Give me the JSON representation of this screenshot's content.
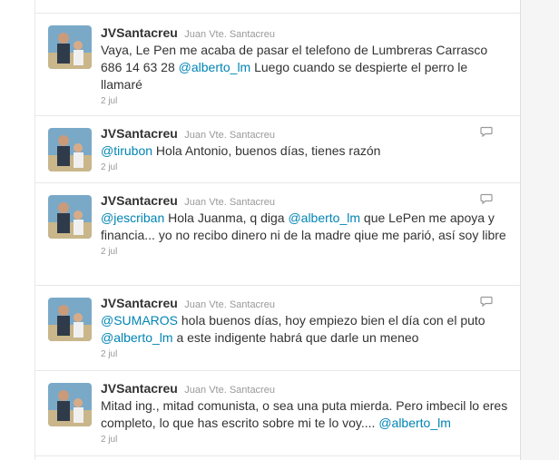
{
  "colors": {
    "mention": "#0084b4",
    "text": "#333333",
    "meta": "#999999",
    "divider": "#e8e8e8"
  },
  "tweets": [
    {
      "screen_name": "JVSantacreu",
      "full_name": "Juan Vte. Santacreu",
      "segments": [
        "Vaya, Le Pen me acaba de pasar el telefono de Lumbreras Carrasco 686 14 63 28 ",
        "@alberto_lm",
        " Luego cuando se despierte el perro le llamaré"
      ],
      "time": "2 jul",
      "has_reply_icon": false,
      "icon": "reply-icon"
    },
    {
      "screen_name": "JVSantacreu",
      "full_name": "Juan Vte. Santacreu",
      "segments": [
        "@tirubon",
        " Hola Antonio, buenos días, tienes razón"
      ],
      "time": "2 jul",
      "has_reply_icon": true,
      "icon": "reply-icon"
    },
    {
      "screen_name": "JVSantacreu",
      "full_name": "Juan Vte. Santacreu",
      "segments": [
        "@jescriban",
        " Hola Juanma, q diga ",
        "@alberto_lm",
        " que LePen me apoya y financia... yo no recibo dinero ni de la madre qiue me parió, así soy libre"
      ],
      "time": "2 jul",
      "has_reply_icon": true,
      "icon": "reply-icon"
    },
    {
      "screen_name": "JVSantacreu",
      "full_name": "Juan Vte. Santacreu",
      "segments": [
        "@SUMAROS",
        " hola buenos días, hoy empiezo bien el día con el puto ",
        "@alberto_lm",
        " a este indigente habrá que darle un meneo"
      ],
      "time": "2 jul",
      "has_reply_icon": true,
      "icon": "reply-icon"
    },
    {
      "screen_name": "JVSantacreu",
      "full_name": "Juan Vte. Santacreu",
      "segments": [
        "Mitad ing., mitad comunista, o sea una puta mierda. Pero imbecil lo eres completo, lo que has escrito sobre mi te lo voy.... ",
        "@alberto_lm"
      ],
      "time": "2 jul",
      "has_reply_icon": false,
      "icon": "reply-icon"
    }
  ]
}
